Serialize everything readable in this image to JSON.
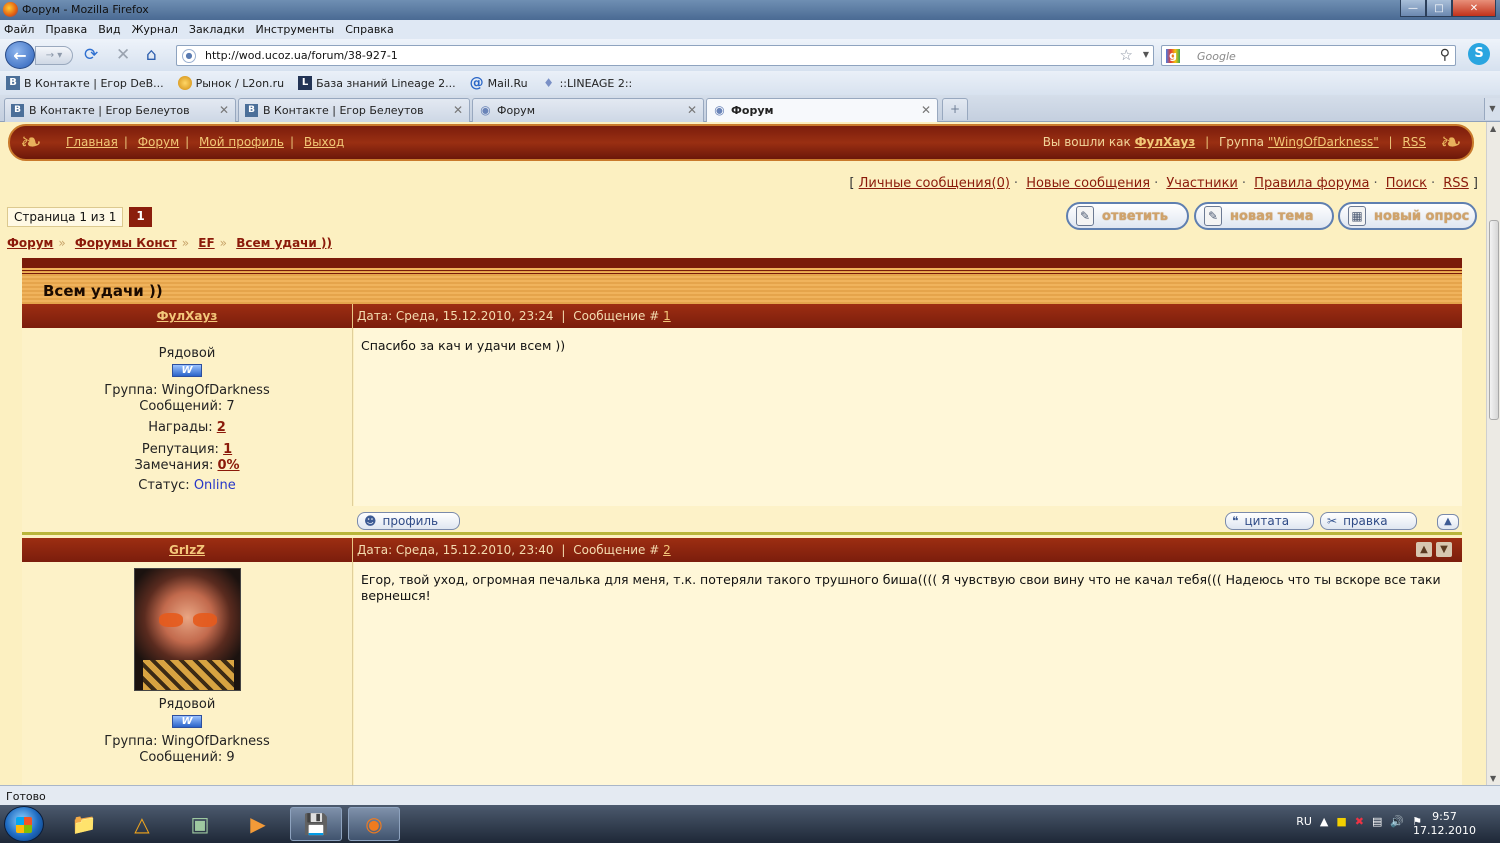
{
  "window": {
    "title": "Форум - Mozilla Firefox"
  },
  "menu": [
    "Файл",
    "Правка",
    "Вид",
    "Журнал",
    "Закладки",
    "Инструменты",
    "Справка"
  ],
  "address": {
    "url": "http://wod.ucoz.ua/forum/38-927-1"
  },
  "search": {
    "placeholder": "Google"
  },
  "bookmarks": [
    {
      "label": "В Контакте | Егор DeB...",
      "icon": "vk-icon"
    },
    {
      "label": "Рынок / L2on.ru",
      "icon": "coin-icon"
    },
    {
      "label": "База знаний Lineage 2...",
      "icon": "book-icon"
    },
    {
      "label": "Mail.Ru",
      "icon": "at-icon"
    },
    {
      "label": "::LINEAGE 2::",
      "icon": "drop-icon"
    }
  ],
  "tabs": [
    {
      "label": "В Контакте | Егор Белеутов",
      "active": false
    },
    {
      "label": "В Контакте | Егор Белеутов",
      "active": false
    },
    {
      "label": "Форум",
      "active": false
    },
    {
      "label": "Форум",
      "active": true
    }
  ],
  "forum_nav": {
    "links": [
      "Главная",
      "Форум",
      "Мой профиль",
      "Выход"
    ],
    "logged_in_prefix": "Вы вошли как",
    "username": "ФулХауз",
    "group_prefix": "Группа",
    "group": "\"WingOfDarkness\"",
    "rss": "RSS"
  },
  "top_links": {
    "open": "[",
    "items": [
      "Личные сообщения(0)",
      "Новые сообщения",
      "Участники",
      "Правила форума",
      "Поиск",
      "RSS"
    ],
    "close": "]"
  },
  "pager": {
    "label": "Страница 1 из 1",
    "page": "1"
  },
  "actions": {
    "reply": "ответить",
    "new_topic": "новая тема",
    "new_poll": "новый опрос"
  },
  "breadcrumbs": [
    "Форум",
    "Форумы Конст",
    "EF",
    "Всем удачи ))"
  ],
  "topic": {
    "title": "Всем удачи ))"
  },
  "posts": [
    {
      "author": "ФулХауз",
      "date_label": "Дата: Среда, 15.12.2010, 23:24",
      "msg_label": "Сообщение #",
      "msg_num": "1",
      "rank": "Рядовой",
      "group": "Группа: WingOfDarkness",
      "messages": "Сообщений: 7",
      "awards_label": "Награды:",
      "awards": "2",
      "rep_label": "Репутация:",
      "rep": "1",
      "warn_label": "Замечания:",
      "warn": "0%",
      "status_label": "Статус:",
      "status": "Online",
      "text": "Спасибо за кач и удачи всем ))",
      "profile_btn": "профиль",
      "quote_btn": "цитата",
      "edit_btn": "правка"
    },
    {
      "author": "GrIzZ",
      "date_label": "Дата: Среда, 15.12.2010, 23:40",
      "msg_label": "Сообщение #",
      "msg_num": "2",
      "rank": "Рядовой",
      "group": "Группа: WingOfDarkness",
      "messages": "Сообщений: 9",
      "text": "Егор, твой уход, огромная печалька для меня, т.к. потеряли такого трушного биша(((( Я чувствую свои вину что не качал тебя((( Надеюсь что ты вскоре все таки вернешся!"
    }
  ],
  "status_bar": "Готово",
  "taskbar": {
    "lang": "RU",
    "time": "9:57",
    "date": "17.12.2010"
  },
  "colors": {
    "forum_red": "#8b1a0a",
    "forum_bg": "#fcf0c1",
    "link_gold": "#f3c77a"
  }
}
